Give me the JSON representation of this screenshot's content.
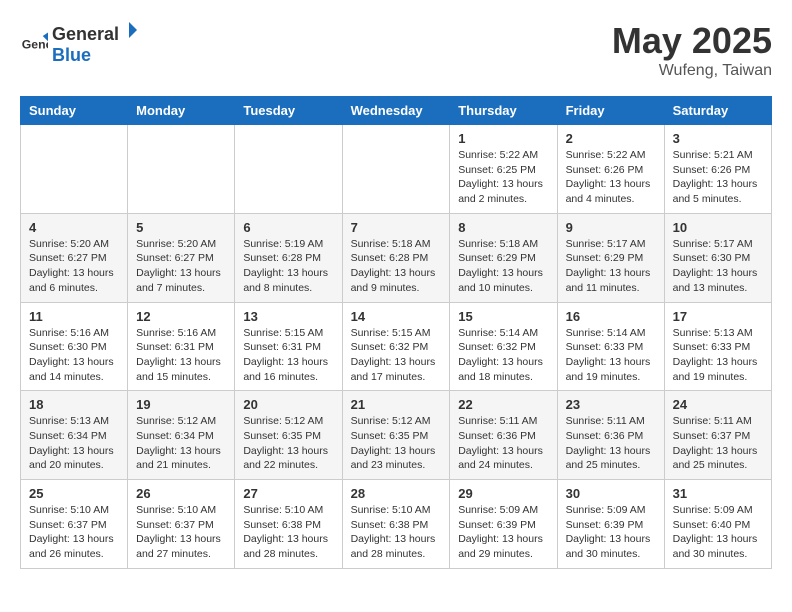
{
  "header": {
    "logo_general": "General",
    "logo_blue": "Blue",
    "title": "May 2025",
    "location": "Wufeng, Taiwan"
  },
  "weekdays": [
    "Sunday",
    "Monday",
    "Tuesday",
    "Wednesday",
    "Thursday",
    "Friday",
    "Saturday"
  ],
  "weeks": [
    [
      {
        "day": "",
        "info": ""
      },
      {
        "day": "",
        "info": ""
      },
      {
        "day": "",
        "info": ""
      },
      {
        "day": "",
        "info": ""
      },
      {
        "day": "1",
        "info": "Sunrise: 5:22 AM\nSunset: 6:25 PM\nDaylight: 13 hours\nand 2 minutes."
      },
      {
        "day": "2",
        "info": "Sunrise: 5:22 AM\nSunset: 6:26 PM\nDaylight: 13 hours\nand 4 minutes."
      },
      {
        "day": "3",
        "info": "Sunrise: 5:21 AM\nSunset: 6:26 PM\nDaylight: 13 hours\nand 5 minutes."
      }
    ],
    [
      {
        "day": "4",
        "info": "Sunrise: 5:20 AM\nSunset: 6:27 PM\nDaylight: 13 hours\nand 6 minutes."
      },
      {
        "day": "5",
        "info": "Sunrise: 5:20 AM\nSunset: 6:27 PM\nDaylight: 13 hours\nand 7 minutes."
      },
      {
        "day": "6",
        "info": "Sunrise: 5:19 AM\nSunset: 6:28 PM\nDaylight: 13 hours\nand 8 minutes."
      },
      {
        "day": "7",
        "info": "Sunrise: 5:18 AM\nSunset: 6:28 PM\nDaylight: 13 hours\nand 9 minutes."
      },
      {
        "day": "8",
        "info": "Sunrise: 5:18 AM\nSunset: 6:29 PM\nDaylight: 13 hours\nand 10 minutes."
      },
      {
        "day": "9",
        "info": "Sunrise: 5:17 AM\nSunset: 6:29 PM\nDaylight: 13 hours\nand 11 minutes."
      },
      {
        "day": "10",
        "info": "Sunrise: 5:17 AM\nSunset: 6:30 PM\nDaylight: 13 hours\nand 13 minutes."
      }
    ],
    [
      {
        "day": "11",
        "info": "Sunrise: 5:16 AM\nSunset: 6:30 PM\nDaylight: 13 hours\nand 14 minutes."
      },
      {
        "day": "12",
        "info": "Sunrise: 5:16 AM\nSunset: 6:31 PM\nDaylight: 13 hours\nand 15 minutes."
      },
      {
        "day": "13",
        "info": "Sunrise: 5:15 AM\nSunset: 6:31 PM\nDaylight: 13 hours\nand 16 minutes."
      },
      {
        "day": "14",
        "info": "Sunrise: 5:15 AM\nSunset: 6:32 PM\nDaylight: 13 hours\nand 17 minutes."
      },
      {
        "day": "15",
        "info": "Sunrise: 5:14 AM\nSunset: 6:32 PM\nDaylight: 13 hours\nand 18 minutes."
      },
      {
        "day": "16",
        "info": "Sunrise: 5:14 AM\nSunset: 6:33 PM\nDaylight: 13 hours\nand 19 minutes."
      },
      {
        "day": "17",
        "info": "Sunrise: 5:13 AM\nSunset: 6:33 PM\nDaylight: 13 hours\nand 19 minutes."
      }
    ],
    [
      {
        "day": "18",
        "info": "Sunrise: 5:13 AM\nSunset: 6:34 PM\nDaylight: 13 hours\nand 20 minutes."
      },
      {
        "day": "19",
        "info": "Sunrise: 5:12 AM\nSunset: 6:34 PM\nDaylight: 13 hours\nand 21 minutes."
      },
      {
        "day": "20",
        "info": "Sunrise: 5:12 AM\nSunset: 6:35 PM\nDaylight: 13 hours\nand 22 minutes."
      },
      {
        "day": "21",
        "info": "Sunrise: 5:12 AM\nSunset: 6:35 PM\nDaylight: 13 hours\nand 23 minutes."
      },
      {
        "day": "22",
        "info": "Sunrise: 5:11 AM\nSunset: 6:36 PM\nDaylight: 13 hours\nand 24 minutes."
      },
      {
        "day": "23",
        "info": "Sunrise: 5:11 AM\nSunset: 6:36 PM\nDaylight: 13 hours\nand 25 minutes."
      },
      {
        "day": "24",
        "info": "Sunrise: 5:11 AM\nSunset: 6:37 PM\nDaylight: 13 hours\nand 25 minutes."
      }
    ],
    [
      {
        "day": "25",
        "info": "Sunrise: 5:10 AM\nSunset: 6:37 PM\nDaylight: 13 hours\nand 26 minutes."
      },
      {
        "day": "26",
        "info": "Sunrise: 5:10 AM\nSunset: 6:37 PM\nDaylight: 13 hours\nand 27 minutes."
      },
      {
        "day": "27",
        "info": "Sunrise: 5:10 AM\nSunset: 6:38 PM\nDaylight: 13 hours\nand 28 minutes."
      },
      {
        "day": "28",
        "info": "Sunrise: 5:10 AM\nSunset: 6:38 PM\nDaylight: 13 hours\nand 28 minutes."
      },
      {
        "day": "29",
        "info": "Sunrise: 5:09 AM\nSunset: 6:39 PM\nDaylight: 13 hours\nand 29 minutes."
      },
      {
        "day": "30",
        "info": "Sunrise: 5:09 AM\nSunset: 6:39 PM\nDaylight: 13 hours\nand 30 minutes."
      },
      {
        "day": "31",
        "info": "Sunrise: 5:09 AM\nSunset: 6:40 PM\nDaylight: 13 hours\nand 30 minutes."
      }
    ]
  ]
}
